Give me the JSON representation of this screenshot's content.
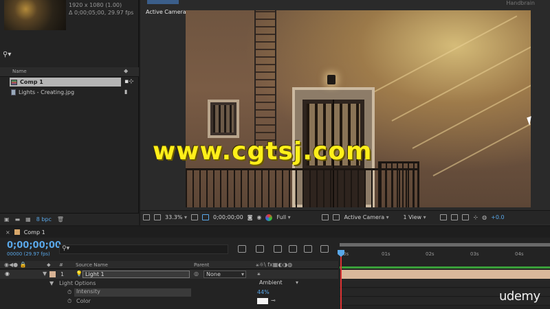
{
  "project": {
    "metadata": {
      "dimensions": "1920 x 1080 (1.00)",
      "duration": "Δ 0;00;05;00, 29.97 fps"
    },
    "search_icon": "search-icon",
    "column_header": "Name",
    "items": [
      {
        "label": "Comp 1",
        "type": "composition",
        "selected": true
      },
      {
        "label": "Lights - Creating.jpg",
        "type": "image",
        "selected": false
      }
    ],
    "footer": {
      "bit_depth": "8 bpc"
    }
  },
  "viewer": {
    "tab_right": "Handbrain",
    "camera_label": "Active Camera",
    "toolbar": {
      "zoom": "33.3%",
      "timecode": "0;00;00;00",
      "resolution": "Full",
      "camera": "Active Camera",
      "view_layout": "1 View",
      "exposure": "+0.0"
    }
  },
  "watermark": "www.cgtsj.com",
  "timeline": {
    "tab_label": "Comp 1",
    "timecode": "0;00;00;00",
    "frame_info": "00000 (29.97 fps)",
    "columns": {
      "number": "#",
      "source_name": "Source Name",
      "parent": "Parent"
    },
    "layer": {
      "number": "1",
      "name": "Light 1",
      "parent": "None"
    },
    "properties": {
      "group": "Light Options",
      "light_type": "Ambient",
      "intensity_label": "Intensity",
      "intensity_value": "44%",
      "color_label": "Color"
    },
    "ruler": [
      "0s",
      "01s",
      "02s",
      "03s",
      "04s"
    ]
  },
  "branding": "udemy",
  "colors": {
    "accent": "#59a7e8",
    "layer_bar": "#d9b89b",
    "playhead": "#dd3333",
    "watermark": "#ffef1a"
  }
}
